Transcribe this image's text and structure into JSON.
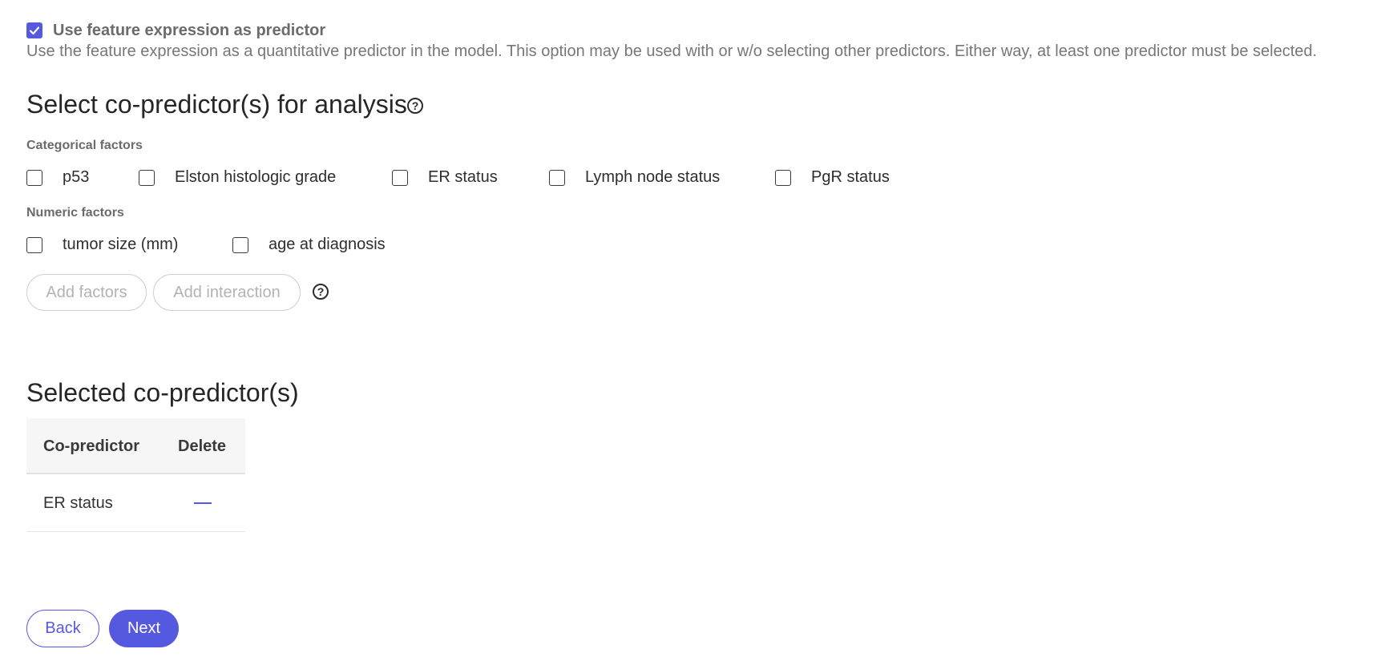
{
  "feature_expression": {
    "checked": true,
    "label": "Use feature expression as predictor",
    "description": "Use the feature expression as a quantitative predictor in the model. This option may be used with or w/o selecting other predictors. Either way, at least one predictor must be selected."
  },
  "co_predictor_section": {
    "title": "Select co-predictor(s) for analysis",
    "help_glyph": "?"
  },
  "categorical": {
    "label": "Categorical factors",
    "items": [
      {
        "label": "p53",
        "checked": false
      },
      {
        "label": "Elston histologic grade",
        "checked": false
      },
      {
        "label": "ER status",
        "checked": false
      },
      {
        "label": "Lymph node status",
        "checked": false
      },
      {
        "label": "PgR status",
        "checked": false
      }
    ]
  },
  "numeric": {
    "label": "Numeric factors",
    "items": [
      {
        "label": "tumor size (mm)",
        "checked": false
      },
      {
        "label": "age at diagnosis",
        "checked": false
      }
    ]
  },
  "actions": {
    "add_factors": "Add factors",
    "add_interaction": "Add interaction",
    "help_glyph": "?"
  },
  "selected": {
    "title": "Selected co-predictor(s)",
    "columns": [
      "Co-predictor",
      "Delete"
    ],
    "rows": [
      {
        "name": "ER status"
      }
    ]
  },
  "nav": {
    "back": "Back",
    "next": "Next"
  },
  "colors": {
    "accent": "#5459e0"
  }
}
